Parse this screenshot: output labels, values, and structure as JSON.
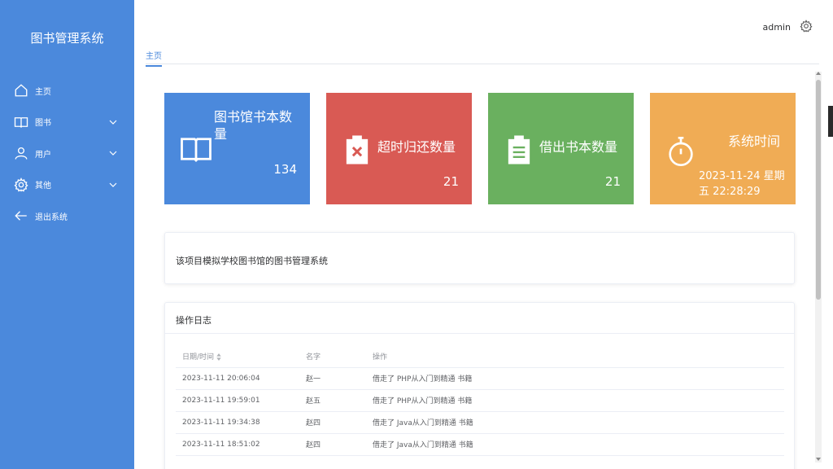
{
  "app": {
    "title": "图书管理系统"
  },
  "sidebar": {
    "items": [
      {
        "label": "主页",
        "icon": "home-icon"
      },
      {
        "label": "图书",
        "icon": "book-icon",
        "expandable": true
      },
      {
        "label": "用户",
        "icon": "user-icon",
        "expandable": true
      },
      {
        "label": "其他",
        "icon": "gear-icon",
        "expandable": true
      },
      {
        "label": "退出系统",
        "icon": "arrow-left-icon"
      }
    ]
  },
  "header": {
    "user": "admin"
  },
  "tabs": [
    {
      "label": "主页",
      "active": true
    }
  ],
  "cards": [
    {
      "title": "图书馆书本数量",
      "value": "134",
      "color": "#4b89dc",
      "icon": "open-book-icon"
    },
    {
      "title": "超时归还数量",
      "value": "21",
      "color": "#d95a54",
      "icon": "clipboard-x-icon"
    },
    {
      "title": "借出书本数量",
      "value": "21",
      "color": "#6ab05f",
      "icon": "clipboard-list-icon"
    },
    {
      "title": "系统时间",
      "value": "2023-11-24 星期五 22:28:29",
      "color": "#f0ac55",
      "icon": "stopwatch-icon"
    }
  ],
  "intro": {
    "text": "该项目模拟学校图书馆的图书管理系统"
  },
  "log": {
    "title": "操作日志",
    "columns": [
      "日期/时间",
      "名字",
      "操作"
    ],
    "rows": [
      [
        "2023-11-11 20:06:04",
        "赵一",
        "借走了 PHP从入门到精通 书籍"
      ],
      [
        "2023-11-11 19:59:01",
        "赵五",
        "借走了 PHP从入门到精通 书籍"
      ],
      [
        "2023-11-11 19:34:38",
        "赵四",
        "借走了 Java从入门到精通 书籍"
      ],
      [
        "2023-11-11 18:51:02",
        "赵四",
        "借走了 Java从入门到精通 书籍"
      ]
    ]
  }
}
